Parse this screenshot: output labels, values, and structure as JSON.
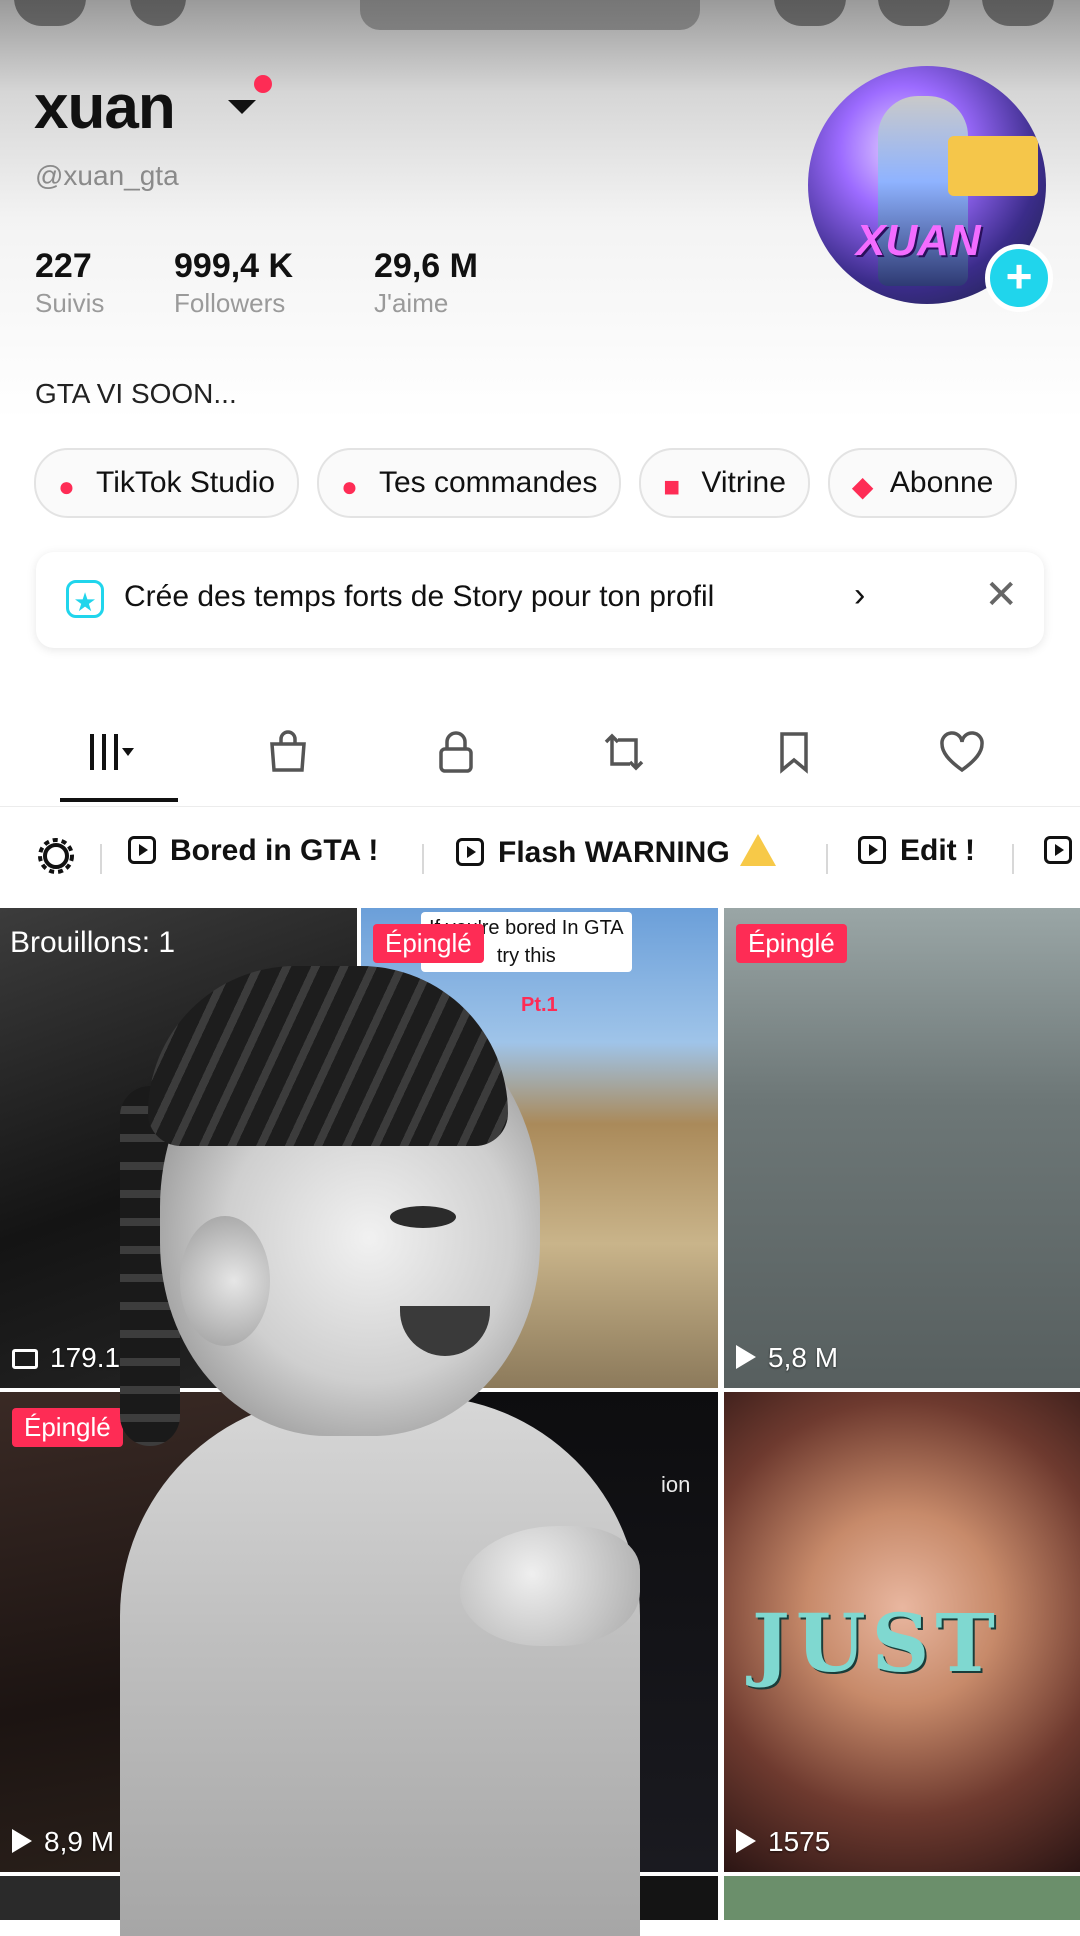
{
  "profile": {
    "username": "xuan",
    "handle": "@xuan_gta",
    "avatar_text": "XUAN",
    "bio": "GTA VI SOON...",
    "stats": [
      {
        "value": "227",
        "label": "Suivis"
      },
      {
        "value": "999,4 K",
        "label": "Followers"
      },
      {
        "value": "29,6 M",
        "label": "J'aime"
      }
    ]
  },
  "chips": [
    {
      "label": "TikTok Studio",
      "icon": "person-star-icon"
    },
    {
      "label": "Tes commandes",
      "icon": "bag-lock-icon"
    },
    {
      "label": "Vitrine",
      "icon": "shop-bag-icon"
    },
    {
      "label": "Abonne",
      "icon": "subscription-icon"
    }
  ],
  "story_banner": {
    "text": "Crée des temps forts de Story pour ton profil",
    "chevron": "›",
    "close": "✕"
  },
  "tabs": [
    {
      "name": "videos-tab",
      "icon": "grid-icon"
    },
    {
      "name": "shop-tab",
      "icon": "shopping-bag-icon"
    },
    {
      "name": "private-tab",
      "icon": "lock-icon"
    },
    {
      "name": "reposts-tab",
      "icon": "repost-icon"
    },
    {
      "name": "saved-tab",
      "icon": "bookmark-icon"
    },
    {
      "name": "liked-tab",
      "icon": "heart-icon"
    }
  ],
  "collections": [
    {
      "label": "Bored in GTA !"
    },
    {
      "label": "Flash WARNING"
    },
    {
      "label": "Edit !"
    }
  ],
  "videos": [
    {
      "drafts": "Brouillons: 1",
      "views": "179.1M"
    },
    {
      "pinned": "Épinglé",
      "caption_line1": "If you're bored In GTA",
      "caption_line2": "try this",
      "part": "Pt.1"
    },
    {
      "pinned": "Épinglé",
      "views": "5,8 M"
    },
    {
      "pinned": "Épinglé",
      "views": "8,9 M"
    },
    {
      "side_text": "ion"
    },
    {
      "overlay_text": "JUST",
      "views": "1575"
    }
  ],
  "colors": {
    "accent_pink": "#fe2c55",
    "accent_cyan": "#20d5ec"
  }
}
